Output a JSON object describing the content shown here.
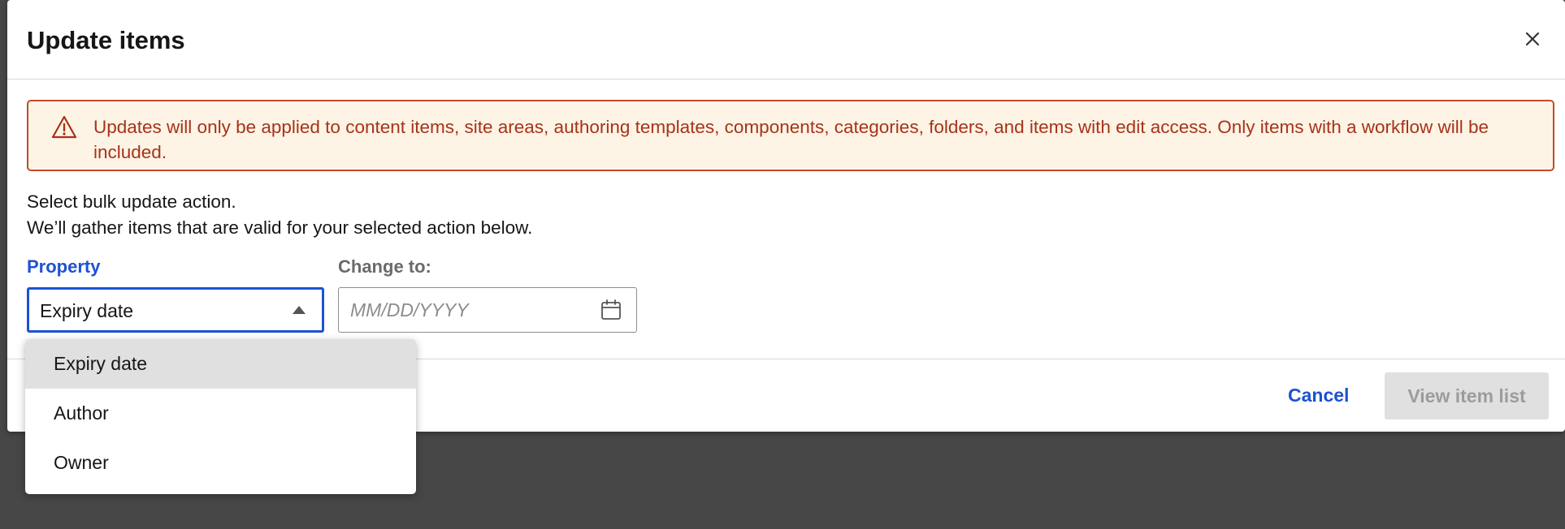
{
  "dialog": {
    "title": "Update items",
    "close_icon": "close-icon"
  },
  "warning": {
    "icon": "warning-icon",
    "text": "Updates will only be applied to content items, site areas, authoring templates, components, categories, folders, and items with edit access. Only items with a workflow will be included."
  },
  "intro": {
    "line1": "Select bulk update action.",
    "line2": "We’ll gather items that are valid for your selected action below."
  },
  "property": {
    "label": "Property",
    "selected": "Expiry date",
    "options": [
      "Expiry date",
      "Author",
      "Owner"
    ]
  },
  "change_to": {
    "label": "Change to:",
    "placeholder": "MM/DD/YYYY",
    "calendar_icon": "calendar-icon"
  },
  "footer": {
    "cancel_label": "Cancel",
    "view_label": "View item list"
  },
  "colors": {
    "accent": "#1c52d3",
    "warning_border": "#c6492a",
    "warning_bg": "#fdf4e5",
    "warning_text": "#a8321a"
  }
}
